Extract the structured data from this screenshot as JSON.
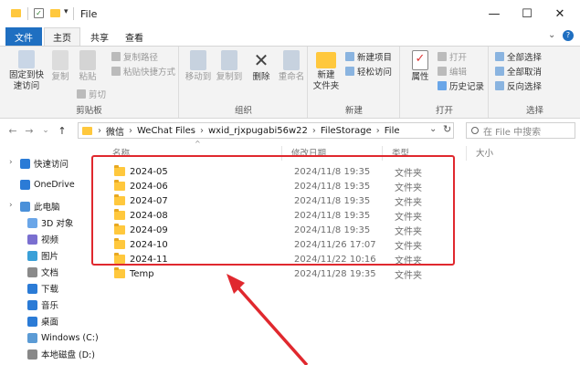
{
  "window": {
    "title": "File",
    "minimize_glyph": "—",
    "maximize_glyph": "☐",
    "close_glyph": "✕",
    "qat_dropdown_glyph": "▾"
  },
  "tabs": {
    "file": "文件",
    "home": "主页",
    "share": "共享",
    "view": "查看"
  },
  "ribbon": {
    "clipboard": {
      "pin_label": "固定到快\n速访问",
      "copy_label": "复制",
      "paste_label": "粘贴",
      "copy_path": "复制路径",
      "paste_shortcut": "粘贴快捷方式",
      "cut": "剪切",
      "group_label": "剪贴板"
    },
    "organize": {
      "move_to": "移动到",
      "copy_to": "复制到",
      "delete": "删除",
      "rename": "重命名",
      "group_label": "组织"
    },
    "new": {
      "new_item": "新建项目",
      "easy_access": "轻松访问",
      "new_folder": "新建\n文件夹",
      "group_label": "新建"
    },
    "open": {
      "properties": "属性",
      "open": "打开",
      "edit": "编辑",
      "history": "历史记录",
      "group_label": "打开"
    },
    "select": {
      "select_all": "全部选择",
      "select_none": "全部取消",
      "invert": "反向选择",
      "group_label": "选择"
    }
  },
  "address": {
    "back": "←",
    "forward": "→",
    "recent": "⌄",
    "up": "↑",
    "breadcrumbs": [
      "微信",
      "WeChat Files",
      "wxid_rjxpugabi56w22",
      "FileStorage",
      "File"
    ],
    "dropdown": "⌄",
    "refresh": "↻",
    "search_placeholder": "在 File 中搜索"
  },
  "nav_pane": {
    "items": [
      {
        "label": "快速访问",
        "icon": "star-icon",
        "color": "#2b7bd6"
      },
      {
        "label": "OneDrive",
        "icon": "cloud-icon",
        "color": "#2b7bd6"
      },
      {
        "label": "此电脑",
        "icon": "computer-icon",
        "color": "#4a90d9"
      },
      {
        "label": "3D 对象",
        "icon": "cube-icon",
        "color": "#6aa6e8"
      },
      {
        "label": "视频",
        "icon": "video-icon",
        "color": "#7a6fd0"
      },
      {
        "label": "图片",
        "icon": "picture-icon",
        "color": "#3aa0d8"
      },
      {
        "label": "文档",
        "icon": "document-icon",
        "color": "#8a8a8a"
      },
      {
        "label": "下载",
        "icon": "download-icon",
        "color": "#2b7bd6"
      },
      {
        "label": "音乐",
        "icon": "music-icon",
        "color": "#2b7bd6"
      },
      {
        "label": "桌面",
        "icon": "desktop-icon",
        "color": "#2b7bd6"
      },
      {
        "label": "Windows (C:)",
        "icon": "drive-icon",
        "color": "#5b9bd5"
      },
      {
        "label": "本地磁盘 (D:)",
        "icon": "drive-icon",
        "color": "#888888"
      }
    ]
  },
  "file_list": {
    "columns": {
      "name": "名称",
      "date": "修改日期",
      "type": "类型",
      "size": "大小"
    },
    "rows": [
      {
        "name": "2024-05",
        "date": "2024/11/8 19:35",
        "type": "文件夹"
      },
      {
        "name": "2024-06",
        "date": "2024/11/8 19:35",
        "type": "文件夹"
      },
      {
        "name": "2024-07",
        "date": "2024/11/8 19:35",
        "type": "文件夹"
      },
      {
        "name": "2024-08",
        "date": "2024/11/8 19:35",
        "type": "文件夹"
      },
      {
        "name": "2024-09",
        "date": "2024/11/8 19:35",
        "type": "文件夹"
      },
      {
        "name": "2024-10",
        "date": "2024/11/26 17:07",
        "type": "文件夹"
      },
      {
        "name": "2024-11",
        "date": "2024/11/22 10:16",
        "type": "文件夹"
      },
      {
        "name": "Temp",
        "date": "2024/11/28 19:35",
        "type": "文件夹"
      }
    ]
  },
  "colors": {
    "accent": "#1f6fc1",
    "highlight": "#e0282e",
    "folder": "#ffc83d"
  }
}
